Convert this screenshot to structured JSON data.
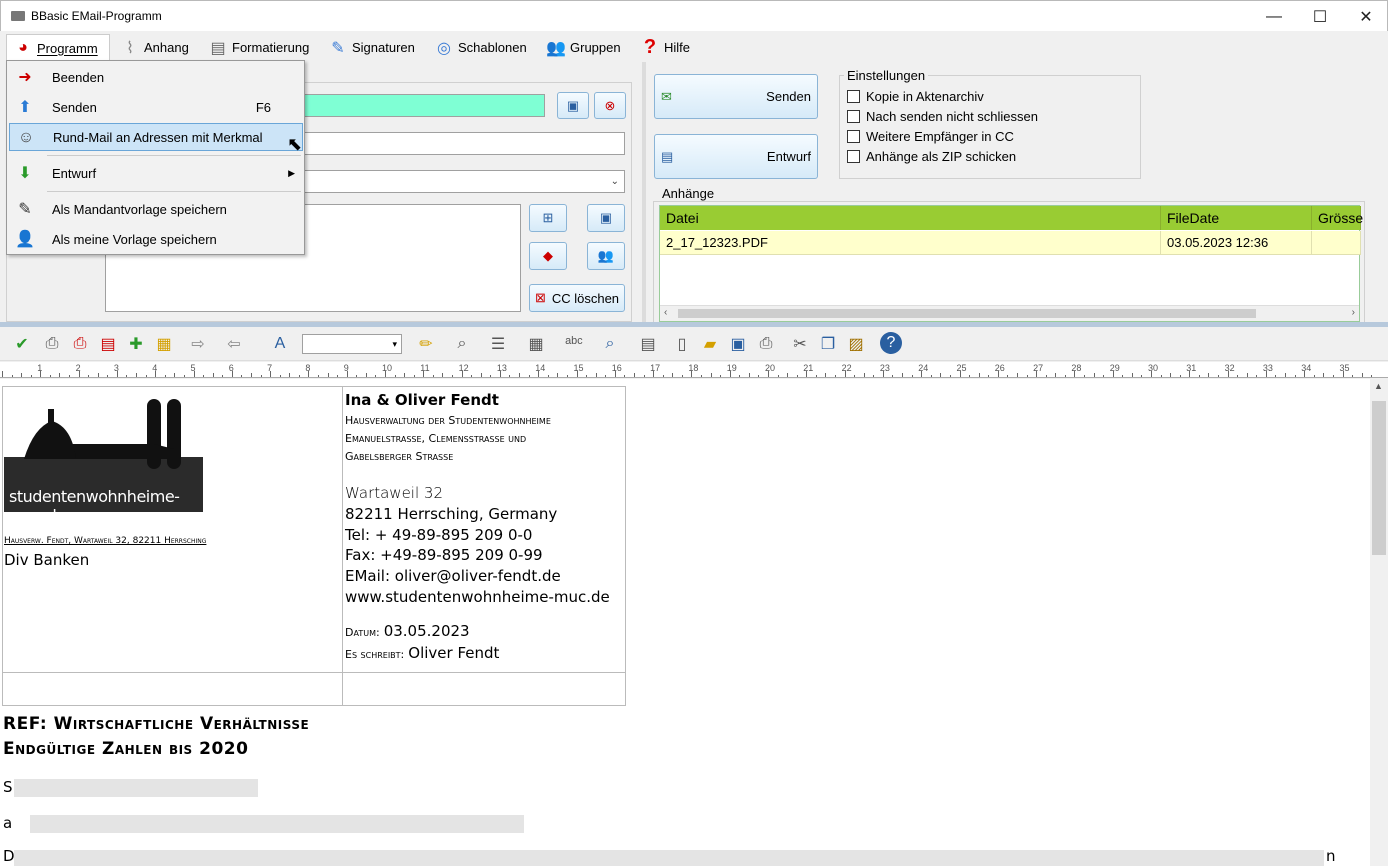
{
  "window": {
    "title": "BBasic EMail-Programm",
    "min": "—",
    "max": "☐",
    "close": "✕"
  },
  "menu": [
    {
      "label": "Programm",
      "icon": "program-icon"
    },
    {
      "label": "Anhang",
      "icon": "paperclip-icon"
    },
    {
      "label": "Formatierung",
      "icon": "format-icon"
    },
    {
      "label": "Signaturen",
      "icon": "signature-icon"
    },
    {
      "label": "Schablonen",
      "icon": "template-icon"
    },
    {
      "label": "Gruppen",
      "icon": "group-icon"
    },
    {
      "label": "Hilfe",
      "icon": "help-icon"
    }
  ],
  "dropdown": [
    {
      "label": "Beenden",
      "shortcut": ""
    },
    {
      "label": "Senden",
      "shortcut": "F6"
    },
    {
      "label": "Rund-Mail an Adressen mit Merkmal",
      "shortcut": ""
    },
    {
      "label": "Entwurf",
      "shortcut": ""
    },
    {
      "label": "Als Mandantvorlage speichern",
      "shortcut": ""
    },
    {
      "label": "Als meine Vorlage speichern",
      "shortcut": ""
    }
  ],
  "actions": {
    "send": "Senden",
    "draft": "Entwurf",
    "cc_clear": "CC löschen"
  },
  "settings": {
    "title": "Einstellungen",
    "options": [
      "Kopie in Aktenarchiv",
      "Nach senden nicht schliessen",
      "Weitere Empfänger in CC",
      "Anhänge als ZIP schicken"
    ]
  },
  "attachments": {
    "title": "Anhänge",
    "columns": [
      "Datei",
      "FileDate",
      "Grösse"
    ],
    "rows": [
      {
        "file": "2_17_12323.PDF",
        "date": "03.05.2023 12:36",
        "size": ""
      }
    ]
  },
  "letter": {
    "logo_text": "studentenwohnheime-muc.de",
    "sender_line": "Hausverw. Fendt, Wartaweil 32, 82211 Herrsching",
    "recipient": "Div Banken",
    "name": "Ina & Oliver Fendt",
    "org_line1": "Hausverwaltung der Studentenwohnheime",
    "org_line2": "Emanuelstrasse, Clemensstrasse und",
    "org_line3": "Gabelsberger Strasse",
    "street": "Wartaweil 32",
    "city": "82211 Herrsching, Germany",
    "tel": "Tel: + 49-89-895 209 0-0",
    "fax": "Fax: +49-89-895 209 0-99",
    "email": "EMail: oliver@oliver-fendt.de",
    "web": "www.studentenwohnheime-muc.de",
    "date_label": "Datum:",
    "date": "03.05.2023",
    "writer_label": "Es schreibt:",
    "writer": "Oliver Fendt",
    "ref_line1": "REF: Wirtschaftliche Verhältnisse",
    "ref_line2": "Endgültige Zahlen bis 2020",
    "body_start1": "S",
    "body_start2": "a",
    "body_start3": "D",
    "body_end3": "n"
  },
  "ruler": [
    "1",
    "2",
    "3",
    "4",
    "5",
    "6",
    "7",
    "8",
    "9",
    "10",
    "11",
    "12",
    "13",
    "14",
    "15",
    "16",
    "17",
    "18",
    "19",
    "20",
    "21",
    "22",
    "23",
    "24",
    "25",
    "26",
    "27",
    "28",
    "29",
    "30",
    "31",
    "32",
    "33",
    "34",
    "35"
  ],
  "colors": {
    "to_field": "#7fffd4",
    "table_header": "#99cc33",
    "table_row": "#ffffcc",
    "highlight": "#cce4f7"
  }
}
